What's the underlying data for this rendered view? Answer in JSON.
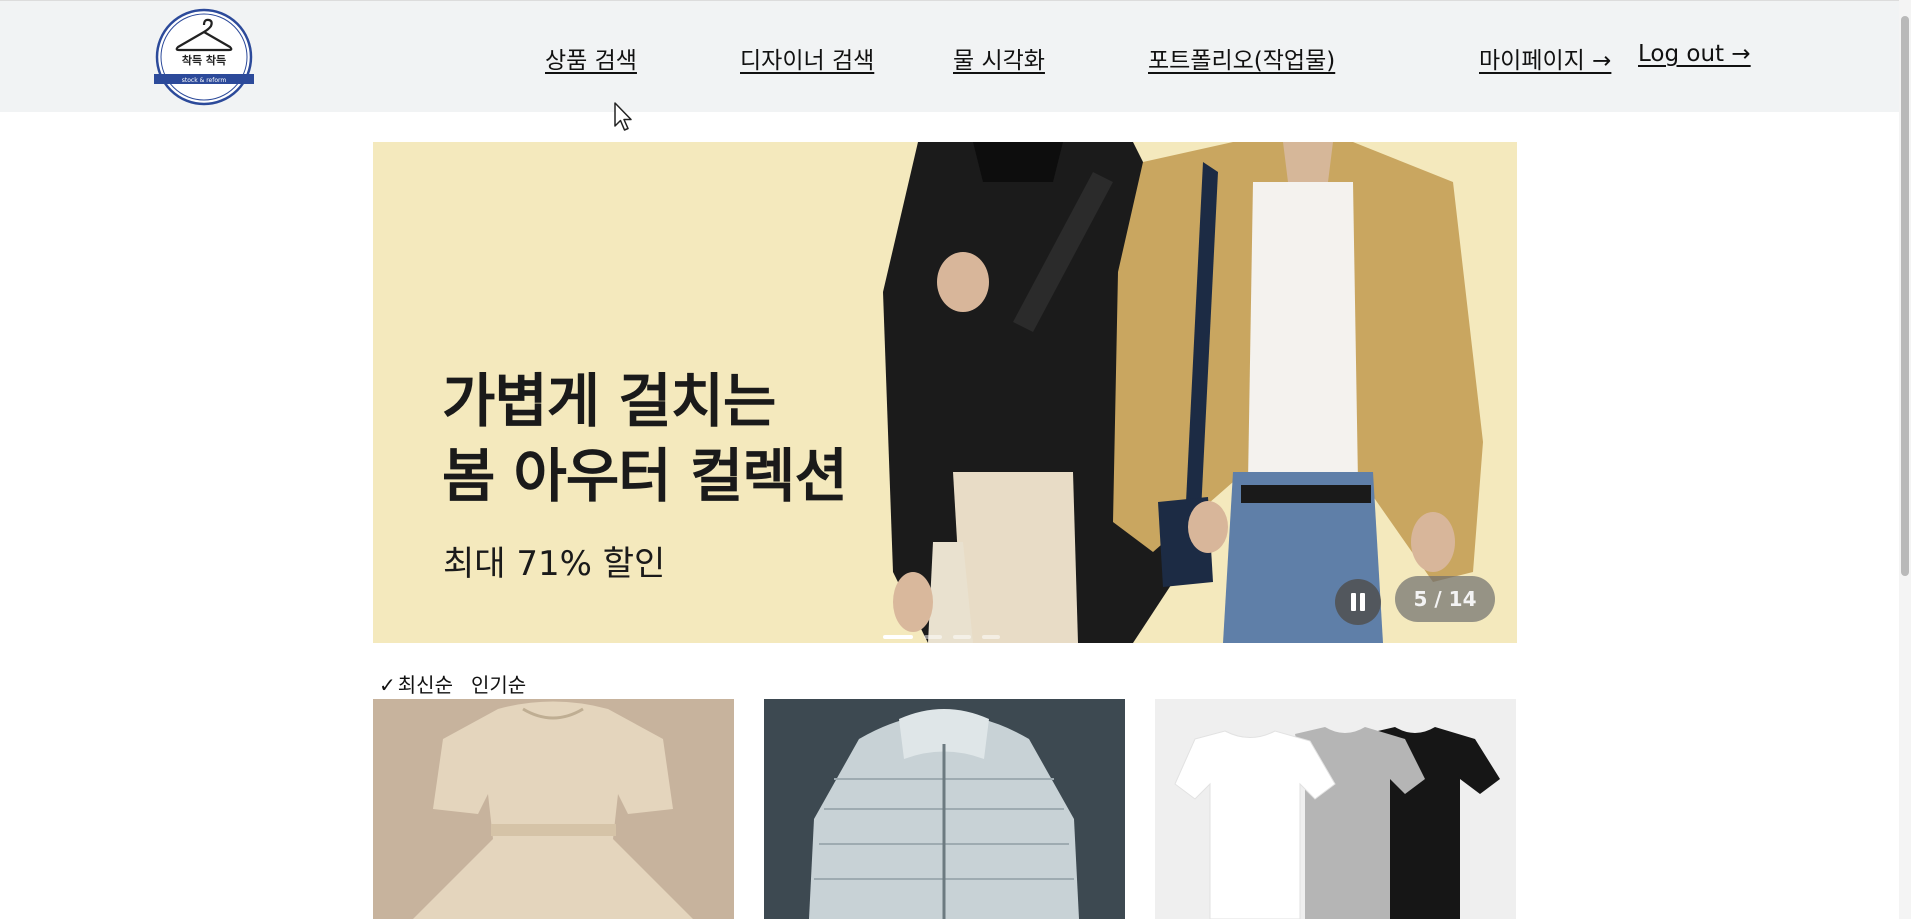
{
  "header": {
    "logo_text": "착득 착득",
    "logo_ribbon": "stock & reform",
    "nav": [
      "상품 검색",
      "디자이너 검색",
      "물 시각화",
      "포트폴리오(작업물)"
    ],
    "mypage": "마이페이지 →",
    "logout": "Log out →"
  },
  "banner": {
    "title": "가볍게 걸치는\n봄 아우터 컬렉션",
    "subtitle": "최대 71% 할인",
    "counter": "5 / 14",
    "current_slide": 5,
    "total_slides": 14
  },
  "sort": {
    "check": "✓",
    "latest": "최신순",
    "popular": "인기순",
    "selected": "최신순"
  },
  "products": [
    {
      "name": "beige-dress"
    },
    {
      "name": "white-puffer-jacket"
    },
    {
      "name": "tshirt-set"
    }
  ],
  "colors": {
    "header_bg": "#f1f3f4",
    "banner_bg": "#f4e9bd",
    "logo_ring": "#2c4a9a"
  }
}
